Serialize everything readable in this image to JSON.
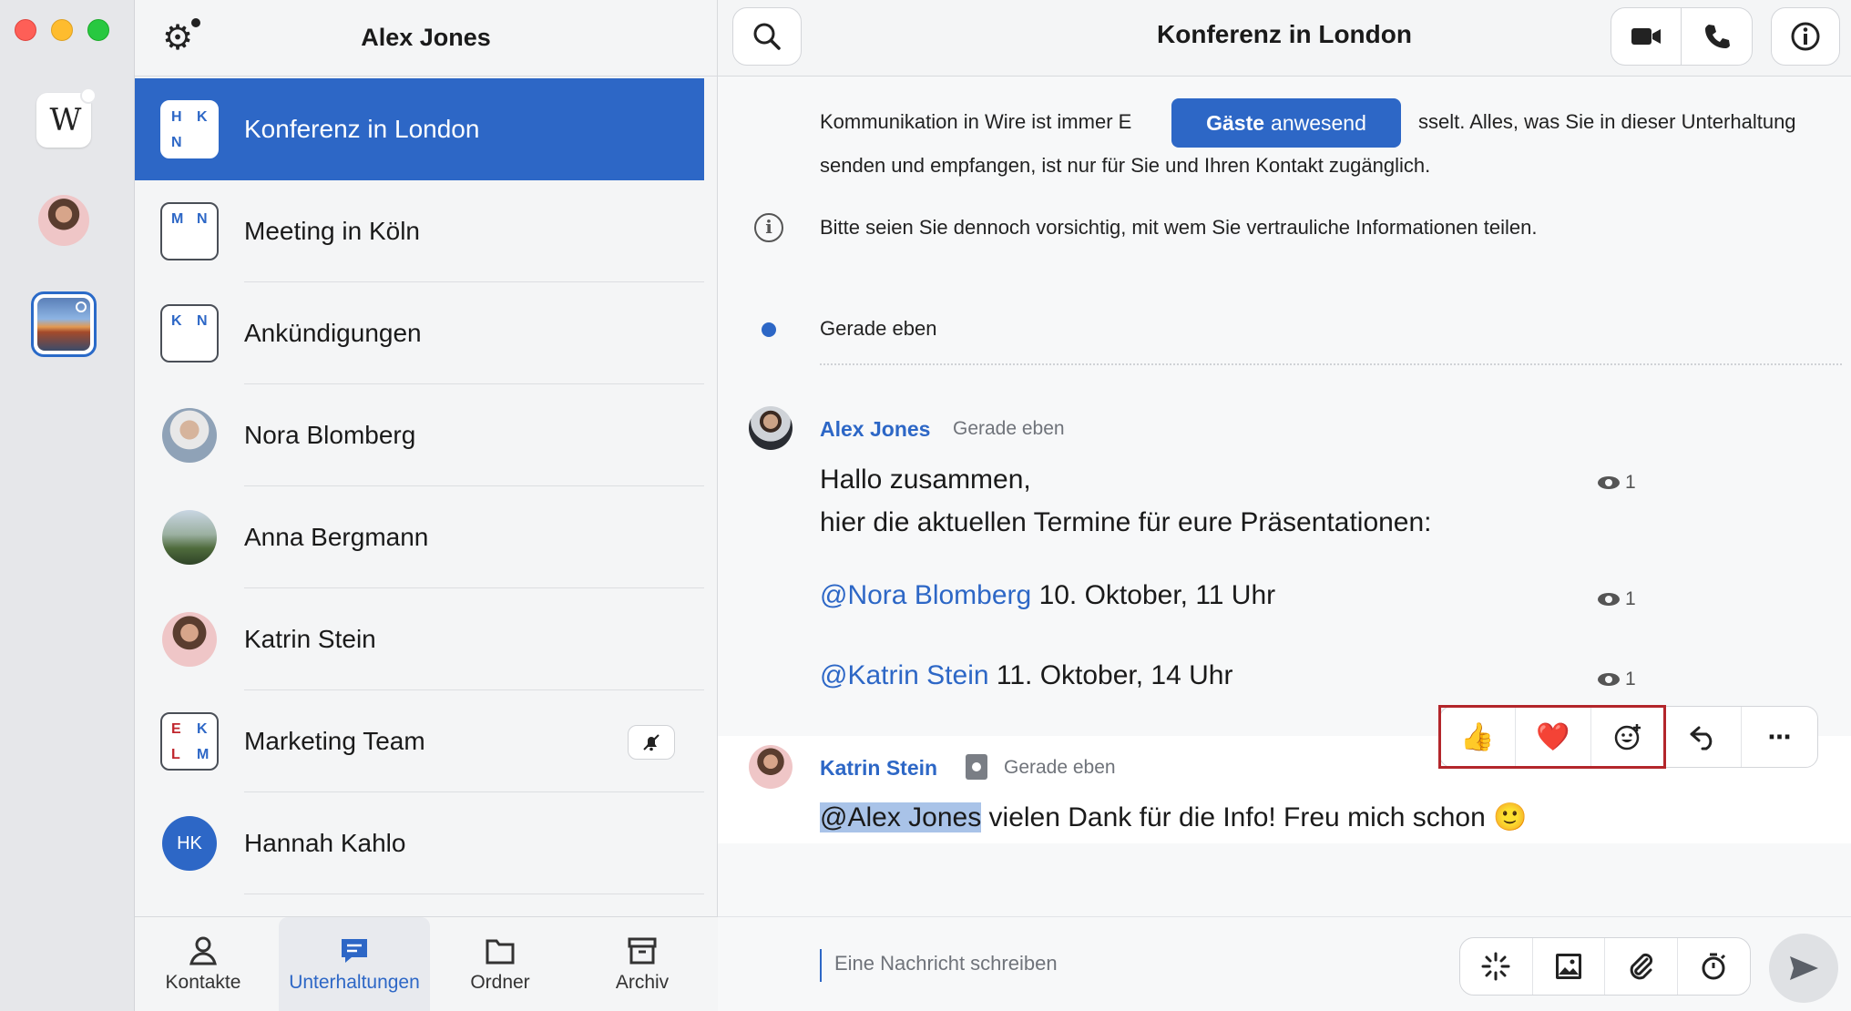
{
  "rail": {
    "items": [
      {
        "name": "wire-logo-tile",
        "glyph": "W"
      },
      {
        "name": "personal-account"
      },
      {
        "name": "team-account"
      }
    ]
  },
  "conversation_list": {
    "title": "Alex Jones",
    "items": [
      {
        "name": "Konferenz in London",
        "type": "group",
        "initials": [
          "H",
          "K",
          "N"
        ],
        "initial_colors": [
          "#2d67c6",
          "#2d67c6",
          "#2d67c6"
        ],
        "active": true
      },
      {
        "name": "Meeting in Köln",
        "type": "group",
        "initials": [
          "M",
          "N"
        ],
        "initial_colors": [
          "#2d67c6",
          "#2d67c6"
        ]
      },
      {
        "name": "Ankündigungen",
        "type": "group",
        "initials": [
          "K",
          "N"
        ],
        "initial_colors": [
          "#2d67c6",
          "#2d67c6"
        ]
      },
      {
        "name": "Nora Blomberg",
        "type": "person"
      },
      {
        "name": "Anna Bergmann",
        "type": "person"
      },
      {
        "name": "Katrin Stein",
        "type": "person"
      },
      {
        "name": "Marketing Team",
        "type": "group",
        "initials": [
          "E",
          "K",
          "L",
          "M"
        ],
        "initial_colors": [
          "#c0262d",
          "#2d67c6",
          "#c0262d",
          "#2d67c6"
        ],
        "muted": true
      },
      {
        "name": "Hannah Kahlo",
        "type": "person",
        "initials_badge": "HK"
      }
    ],
    "bottom_nav": [
      {
        "label": "Kontakte",
        "icon": "person-icon"
      },
      {
        "label": "Unterhaltungen",
        "icon": "chat-icon",
        "active": true
      },
      {
        "label": "Ordner",
        "icon": "folder-icon"
      },
      {
        "label": "Archiv",
        "icon": "archive-icon"
      }
    ]
  },
  "header": {
    "title": "Konferenz in London",
    "guests_banner_bold": "Gäste",
    "guests_banner_rest": "anwesend"
  },
  "system_messages": {
    "encryption_line1_start": "Kommunikation in Wire ist immer E",
    "encryption_line1_end": "sselt. Alles, was Sie in dieser Unterhaltung",
    "encryption_line2": "senden und empfangen, ist nur für Sie und Ihren Kontakt zugänglich.",
    "caution": "Bitte seien Sie dennoch vorsichtig, mit wem Sie vertrauliche Informationen teilen.",
    "timestamp": "Gerade eben"
  },
  "messages": [
    {
      "sender": "Alex Jones",
      "time": "Gerade eben",
      "greeting": "Hallo zusammen,",
      "line2": "hier die aktuellen Termine für eure Präsentationen:",
      "item1_mention": "@Nora Blomberg",
      "item1_text": "10. Oktober, 11 Uhr",
      "item2_mention": "@Katrin Stein",
      "item2_text": "11. Oktober, 14 Uhr",
      "seen_counts": [
        "1",
        "1",
        "1"
      ]
    },
    {
      "sender": "Katrin Stein",
      "time": "Gerade eben",
      "mention": "@Alex Jones",
      "text": "vielen Dank für die Info! Freu mich schon 🙂"
    }
  ],
  "message_actions": {
    "thumbs_up": "👍",
    "heart": "❤️",
    "emoji_picker": "☺",
    "reply": "↩",
    "more": "⋯"
  },
  "composer": {
    "placeholder": "Eine Nachricht schreiben",
    "tools": [
      "ping-icon",
      "image-icon",
      "attachment-icon",
      "timer-icon"
    ]
  },
  "colors": {
    "accent": "#2d67c6",
    "highlight_border": "#b3262b"
  }
}
